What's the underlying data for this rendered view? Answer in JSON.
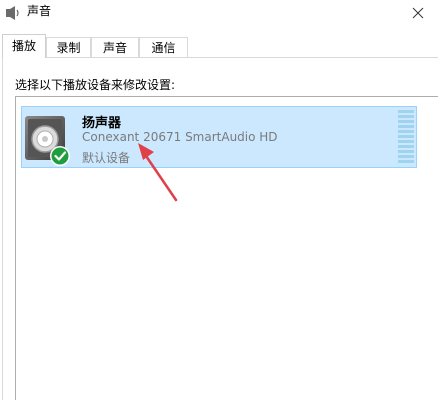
{
  "window": {
    "title": "声音",
    "icon": "speaker-icon"
  },
  "tabs": [
    {
      "label": "播放",
      "active": true
    },
    {
      "label": "录制",
      "active": false
    },
    {
      "label": "声音",
      "active": false
    },
    {
      "label": "通信",
      "active": false
    }
  ],
  "panel": {
    "instruction": "选择以下播放设备来修改设置:"
  },
  "devices": [
    {
      "name": "扬声器",
      "description": "Conexant 20671 SmartAudio HD",
      "status": "默认设备",
      "icon": "speaker-device-icon",
      "badge": "default-check-icon",
      "level": 0
    }
  ],
  "colors": {
    "selection_bg": "#cce8ff",
    "selection_border": "#99d1ff",
    "arrow": "#e0404a",
    "check_green": "#1e9e3e"
  }
}
